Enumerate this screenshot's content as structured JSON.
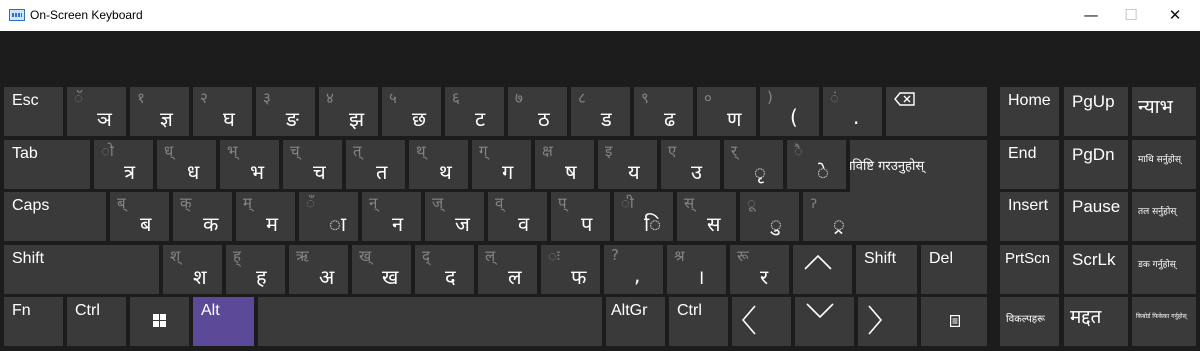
{
  "window": {
    "title": "On-Screen Keyboard",
    "minimize": "—",
    "maximize": "☐",
    "close": "✕"
  },
  "keys": {
    "esc": "Esc",
    "tab": "Tab",
    "caps": "Caps",
    "shift": "Shift",
    "fn": "Fn",
    "ctrl": "Ctrl",
    "alt": "Alt",
    "altgr": "AltGr",
    "ctrl_r": "Ctrl",
    "shift_r": "Shift",
    "del": "Del",
    "n1": {
      "sec": "ॅ",
      "pri": "ञ"
    },
    "n2": {
      "sec": "१",
      "pri": "ज्ञ"
    },
    "n3": {
      "sec": "२",
      "pri": "घ"
    },
    "n4": {
      "sec": "३",
      "pri": "ङ"
    },
    "n5": {
      "sec": "४",
      "pri": "झ"
    },
    "n6": {
      "sec": "५",
      "pri": "छ"
    },
    "n7": {
      "sec": "६",
      "pri": "ट"
    },
    "n8": {
      "sec": "७",
      "pri": "ठ"
    },
    "n9": {
      "sec": "८",
      "pri": "ड"
    },
    "n10": {
      "sec": "९",
      "pri": "ढ"
    },
    "n11": {
      "sec": "०",
      "pri": "ण"
    },
    "n12": {
      "sec": ")",
      "pri": "("
    },
    "n13": {
      "sec": "ं",
      "pri": "."
    },
    "q1": {
      "sec": "ो",
      "pri": "त्र"
    },
    "q2": {
      "sec": "ध्",
      "pri": "ध"
    },
    "q3": {
      "sec": "भ्",
      "pri": "भ"
    },
    "q4": {
      "sec": "च्",
      "pri": "च"
    },
    "q5": {
      "sec": "त्",
      "pri": "त"
    },
    "q6": {
      "sec": "थ्",
      "pri": "थ"
    },
    "q7": {
      "sec": "ग्",
      "pri": "ग"
    },
    "q8": {
      "sec": "क्ष",
      "pri": "ष"
    },
    "q9": {
      "sec": "इ",
      "pri": "य"
    },
    "q10": {
      "sec": "ए",
      "pri": "उ"
    },
    "q11": {
      "sec": "र्",
      "pri": "ृ"
    },
    "q12": {
      "sec": "ै",
      "pri": "े"
    },
    "enter": "प्रविष्टि गरउनुहोस्",
    "a1": {
      "sec": "ब्",
      "pri": "ब"
    },
    "a2": {
      "sec": "क्",
      "pri": "क"
    },
    "a3": {
      "sec": "म्",
      "pri": "म"
    },
    "a4": {
      "sec": "ँ",
      "pri": "ा"
    },
    "a5": {
      "sec": "न्",
      "pri": "न"
    },
    "a6": {
      "sec": "ज्",
      "pri": "ज"
    },
    "a7": {
      "sec": "व्",
      "pri": "व"
    },
    "a8": {
      "sec": "प्",
      "pri": "प"
    },
    "a9": {
      "sec": "ी",
      "pri": "ि"
    },
    "a10": {
      "sec": "स्",
      "pri": "स"
    },
    "a11": {
      "sec": "ू",
      "pri": "ु"
    },
    "a12": {
      "sec": "ॽ",
      "pri": "्र"
    },
    "z1": {
      "sec": "श्",
      "pri": "श"
    },
    "z2": {
      "sec": "ह्",
      "pri": "ह"
    },
    "z3": {
      "sec": "ऋ",
      "pri": "अ"
    },
    "z4": {
      "sec": "ख्",
      "pri": "ख"
    },
    "z5": {
      "sec": "द्",
      "pri": "द"
    },
    "z6": {
      "sec": "ल्",
      "pri": "ल"
    },
    "z7": {
      "sec": "ः",
      "pri": "फ"
    },
    "z8": {
      "sec": "?",
      "pri": ","
    },
    "z9": {
      "sec": "श्र",
      "pri": "।"
    },
    "z10": {
      "sec": "रू",
      "pri": "र"
    }
  },
  "nav": {
    "home": "Home",
    "pgup": "PgUp",
    "navigate": "न्याभ",
    "end": "End",
    "pgdn": "PgDn",
    "move_up": "माथि सर्नुहोस्",
    "insert": "Insert",
    "pause": "Pause",
    "move_down": "तल सर्नुहोस्",
    "prtscn": "PrtScn",
    "scrlk": "ScrLk",
    "dock": "डक गर्नुहोस्",
    "options": "विकल्पहरू",
    "help": "मद्दत",
    "fade": "किबोर्ड फिकेका गर्नुहोस्"
  }
}
